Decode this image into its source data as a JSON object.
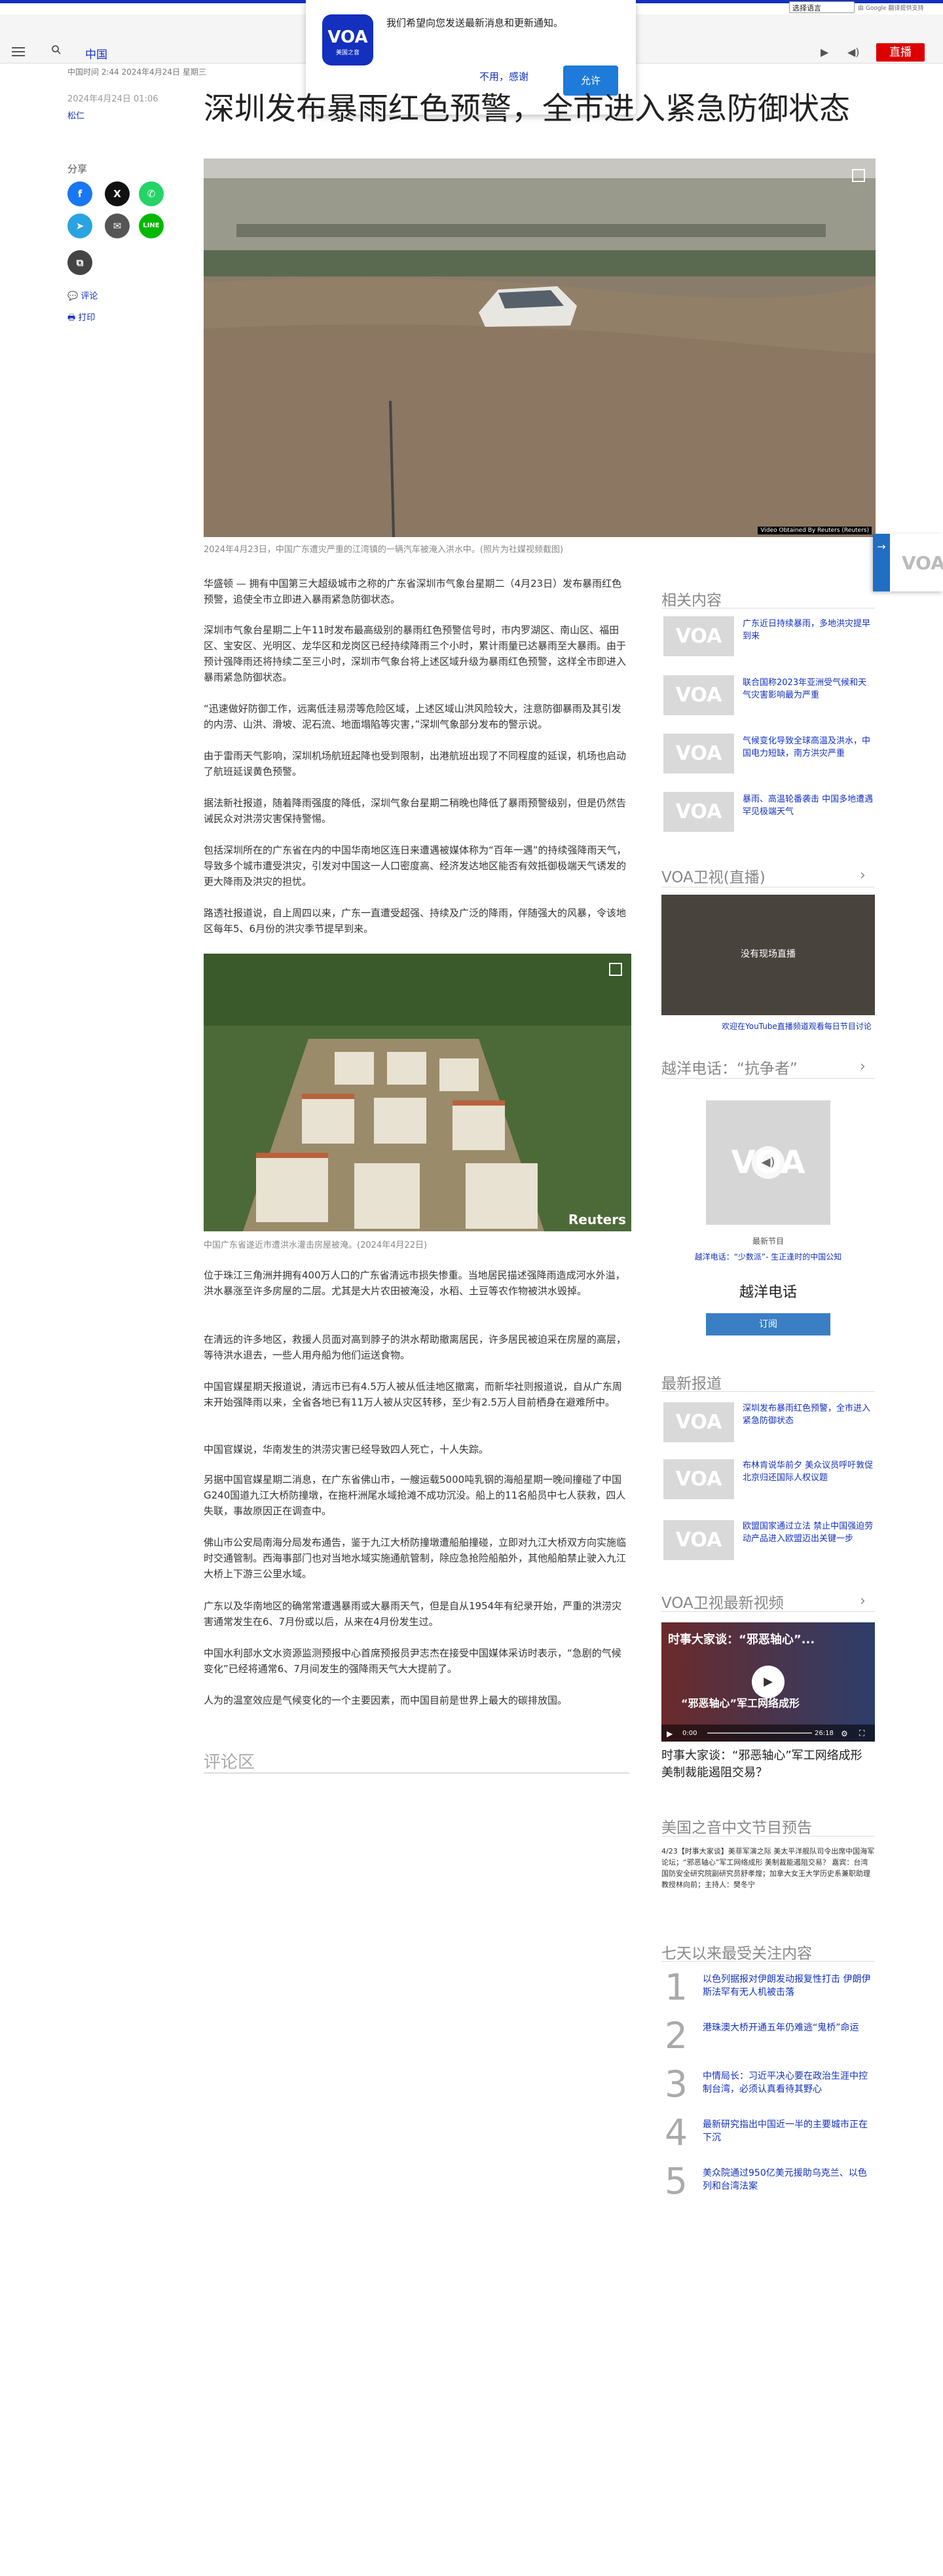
{
  "top_bar": {
    "language_select": "选择语言",
    "google_note": "由 Google 翻译提供支持"
  },
  "header": {
    "brand": "中国",
    "live_label": "直播"
  },
  "popup": {
    "logo_text": "VOA",
    "logo_sub": "美国之音",
    "message": "我们希望向您发送最新消息和更新通知。",
    "decline": "不用，感谢",
    "accept": "允许"
  },
  "article": {
    "dateline": "中国时间 2:44 2024年4月24日 星期三",
    "date": "2024年4月24日 01:06",
    "byline": "松仁",
    "title": "深圳发布暴雨红色预警，全市进入紧急防御状态",
    "share_label": "分享",
    "comment_link": "评论",
    "print_link": "打印",
    "hero_caption": "2024年4月23日，中国广东遭灾严重的江湾镇的一辆汽车被淹入洪水中。(照片为社媒视频截图)",
    "hero_credit": "Video Obtained By Reuters (Reuters)",
    "paragraphs_a": [
      "华盛顿 — 拥有中国第三大超级城市之称的广东省深圳市气象台星期二（4月23日）发布暴雨红色预警，追使全市立即进入暴雨紧急防御状态。",
      "深圳市气象台星期二上午11时发布最高级别的暴雨红色预警信号时，市内罗湖区、南山区、福田区、宝安区、光明区、龙华区和龙岗区已经持续降雨三个小时，累计雨量已达暴雨至大暴雨。由于预计强降雨还将持续二至三小时，深圳市气象台将上述区域升级为暴雨红色预警，这样全市即进入暴雨紧急防御状态。",
      "“迅速做好防御工作，远离低洼易涝等危险区域，上述区域山洪风险较大，注意防御暴雨及其引发的内涝、山洪、滑坡、泥石流、地面塌陷等灾害，”深圳气象部分发布的警示说。",
      "由于雷雨天气影响，深圳机场航班起降也受到限制，出港航班出现了不同程度的延误，机场也启动了航班延误黄色预警。",
      "据法新社报道，随着降雨强度的降低，深圳气象台星期二稍晚也降低了暴雨预警级别，但是仍然告诫民众对洪涝灾害保持警惕。",
      "包括深圳所在的广东省在内的中国华南地区连日来遭遇被媒体称为“百年一遇”的持续强降雨天气，导致多个城市遭受洪灾，引发对中国这一人口密度高、经济发达地区能否有效抵御极端天气诱发的更大降雨及洪灾的担忧。",
      "路透社报道说，自上周四以来，广东一直遭受超强、持续及广泛的降雨，伴随强大的风暴，令该地区每年5、6月份的洪灾季节提早到来。"
    ],
    "photo2_caption": "中国广东省遂近市遭洪水灌击房屋被淹。(2024年4月22日)",
    "photo2_credit": "Reuters",
    "paragraphs_b": [
      "位于珠江三角洲并拥有400万人口的广东省清远市损失惨重。当地居民描述强降雨造成河水外溢，洪水暴涨至许多房屋的二层。尤其是大片农田被淹没，水稻、土豆等农作物被洪水毁掉。",
      "在清远的许多地区，救援人员面对高到脖子的洪水帮助撤离居民，许多居民被迫采在房屋的高层，等待洪水退去，一些人用舟船为他们运送食物。",
      "中国官媒星期天报道说，清远市已有4.5万人被从低洼地区撤离，而新华社则报道说，自从广东周末开始强降雨以来，全省各地已有11万人被从灾区转移，至少有2.5万人目前栖身在避难所中。",
      "中国官媒说，华南发生的洪涝灾害已经导致四人死亡，十人失踪。",
      "另据中国官媒星期二消息，在广东省佛山市，一艘运载5000吨乳钢的海船星期一晚间撞碰了中国G240国道九江大桥防撞墩，在拖杆洲尾水域抢滩不成功沉没。船上的11名船员中七人获救，四人失联，事故原因正在调查中。",
      "佛山市公安局南海分局发布通告，鉴于九江大桥防撞墩遭船舶撞碰，立即对九江大桥双方向实施临时交通管制。西海事部门也对当地水域实施通航管制，除应急抢险船舶外，其他船舶禁止驶入九江大桥上下游三公里水域。",
      "广东以及华南地区的确常常遭遇暴雨或大暴雨天气，但是自从1954年有纪录开始，严重的洪涝灾害通常发生在6、7月份或以后，从来在4月份发生过。",
      "中国水利部水文水资源监测预报中心首席预报员尹志杰在接受中国媒体采访时表示，“急剧的气候变化”已经将通常6、7月间发生的强降雨天气大大提前了。",
      "人为的温室效应是气候变化的一个主要因素，而中国目前是世界上最大的碳排放国。"
    ],
    "comment_section": "评论区"
  },
  "sidebar": {
    "related_title": "相关内容",
    "related": [
      "广东近日持续暴雨，多地洪灾提早到来",
      "联合国称2023年亚洲受气候和天气灾害影响最为严重",
      "气候变化导致全球高温及洪水，中国电力短缺，南方洪灾严重",
      "暴雨、高温轮番袭击 中国多地遭遇罕见极端天气"
    ],
    "tv_title": "VOA卫视(直播)",
    "tv_overlay": "没有现场直播",
    "tv_link": "欢迎在YouTube直播频道观看每日节目讨论",
    "phone_title": "越洋电话：“抗争者”",
    "phone_latest": "最新节目",
    "phone_episode": "越洋电话：“少数派”- 生正逢时的中国公知",
    "phone_program": "越洋电话",
    "phone_subscribe": "订阅",
    "latest_title": "最新报道",
    "latest": [
      "深圳发布暴雨红色预警，全市进入紧急防御状态",
      "布林肯说华前夕 美众议员呼吁敦促北京归还国际人权议题",
      "欧盟国家通过立法 禁止中国强迫劳动产品进入欧盟迈出关键一步"
    ],
    "video_title": "VOA卫视最新视频",
    "video_overlay_title": "时事大家谈：“邪恶轴心”...",
    "video_overlay_banner": "“邪恶轴心”军工网络成形",
    "video_time": "0:00",
    "video_duration": "26:18",
    "video_caption": "时事大家谈：“邪恶轴心”军工网络成形 美制裁能遏阻交易？",
    "preview_title": "美国之音中文节目预告",
    "preview_text": "4/23【时事大家谈】美菲军演之际 美太平洋舰队司令出席中国海军论坛；“邪恶轴心”军工网络成形 美制裁能遏阻交易？ 嘉宾：台湾国防安全研究院副研究员舒孝煌；加拿大女王大学历史系兼职助理教授林向前；主持人：樊冬宁",
    "most_viewed_title": "七天以来最受关注内容",
    "most_viewed": [
      {
        "rank": "1",
        "text": "以色列据报对伊朗发动报复性打击 伊朗伊斯法罕有无人机被击落"
      },
      {
        "rank": "2",
        "text": "港珠澳大桥开通五年仍难逃“鬼桥”命运"
      },
      {
        "rank": "3",
        "text": "中情局长：习近平决心要在政治生涯中控制台湾，必须认真看待其野心"
      },
      {
        "rank": "4",
        "text": "最新研究指出中国近一半的主要城市正在下沉"
      },
      {
        "rank": "5",
        "text": "美众院通过950亿美元援助乌克兰、以色列和台湾法案"
      }
    ]
  },
  "colors": {
    "voa_blue": "#1330bf",
    "live_red": "#dd0000",
    "facebook": "#1877f2",
    "x": "#111111",
    "whatsapp": "#25d366",
    "telegram": "#2aa3e0",
    "email": "#555555",
    "line": "#00b900",
    "copy": "#444444"
  }
}
